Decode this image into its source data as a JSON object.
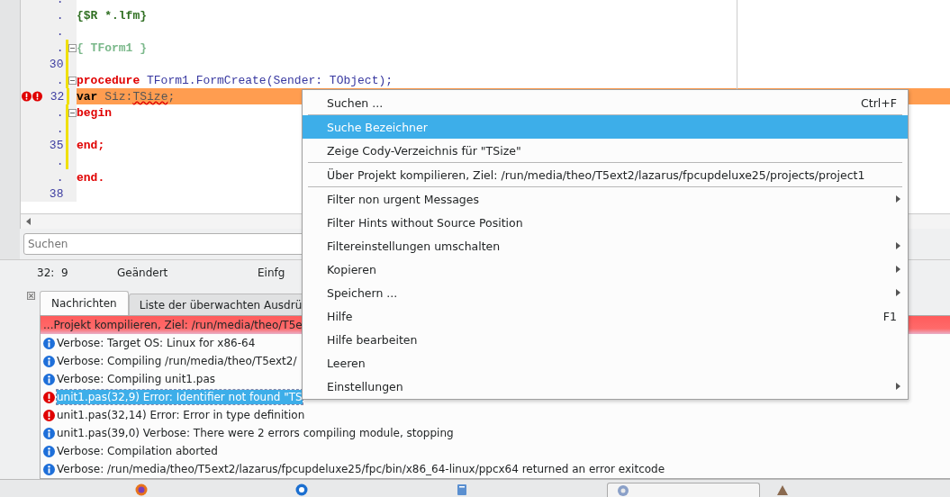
{
  "editor": {
    "lines": [
      {
        "number": ".",
        "modified": false,
        "fold": false,
        "highlighted": false,
        "error": false
      },
      {
        "number": ".",
        "modified": false,
        "fold": false,
        "highlighted": false,
        "error": false,
        "code": [
          {
            "kind": "directive",
            "text": "{$R *.lfm}"
          }
        ]
      },
      {
        "number": ".",
        "modified": false,
        "fold": false,
        "highlighted": false,
        "error": false
      },
      {
        "number": ".",
        "modified": true,
        "fold": true,
        "highlighted": false,
        "error": false,
        "code": [
          {
            "kind": "comment",
            "text": "{ TForm1 }"
          }
        ]
      },
      {
        "number": "30",
        "modified": true,
        "fold": false,
        "highlighted": false,
        "error": false
      },
      {
        "number": ".",
        "modified": true,
        "fold": true,
        "highlighted": false,
        "error": false,
        "code": [
          {
            "kind": "keyword",
            "text": "procedure"
          },
          {
            "kind": "ident",
            "text": " TForm1.FormCreate(Sender: TObject);"
          }
        ]
      },
      {
        "number": "32",
        "modified": true,
        "fold": false,
        "highlighted": true,
        "error": true,
        "code": [
          {
            "kind": "strong",
            "text": "var"
          },
          {
            "kind": "plain",
            "text": " Siz:"
          },
          {
            "kind": "error",
            "text": "TSize"
          },
          {
            "kind": "plain",
            "text": ";"
          }
        ]
      },
      {
        "number": ".",
        "modified": true,
        "fold": true,
        "highlighted": false,
        "error": false,
        "code": [
          {
            "kind": "keyword",
            "text": "begin"
          }
        ]
      },
      {
        "number": ".",
        "modified": true,
        "fold": false,
        "highlighted": false,
        "error": false
      },
      {
        "number": "35",
        "modified": true,
        "fold": false,
        "highlighted": false,
        "error": false,
        "code": [
          {
            "kind": "keyword",
            "text": "end;"
          }
        ]
      },
      {
        "number": ".",
        "modified": true,
        "fold": false,
        "highlighted": false,
        "error": false
      },
      {
        "number": ".",
        "modified": false,
        "fold": false,
        "highlighted": false,
        "error": false,
        "code": [
          {
            "kind": "keyword",
            "text": "end."
          }
        ]
      },
      {
        "number": "38",
        "modified": false,
        "fold": false,
        "highlighted": false,
        "error": false
      }
    ]
  },
  "search": {
    "placeholder": "Suchen"
  },
  "status_bar": {
    "position": "32:  9",
    "modified": "Geändert",
    "mode": "Einfg"
  },
  "messages": {
    "tabs": [
      {
        "label": "Nachrichten",
        "selected": true
      },
      {
        "label": "Liste der überwachten Ausdrü",
        "selected": false
      }
    ],
    "rows": [
      {
        "kind": "header",
        "selected": false,
        "text": "...Projekt kompilieren, Ziel: /run/media/theo/T5e"
      },
      {
        "kind": "info",
        "selected": false,
        "text": "Verbose: Target OS: Linux for x86-64"
      },
      {
        "kind": "info",
        "selected": false,
        "text": "Verbose: Compiling /run/media/theo/T5ext2/"
      },
      {
        "kind": "info",
        "selected": false,
        "text": "Verbose: Compiling unit1.pas"
      },
      {
        "kind": "error",
        "selected": true,
        "text": "unit1.pas(32,9) Error: Identifier not found \"TS"
      },
      {
        "kind": "error",
        "selected": false,
        "text": "unit1.pas(32,14) Error: Error in type definition"
      },
      {
        "kind": "info",
        "selected": false,
        "text": "unit1.pas(39,0) Verbose: There were 2 errors compiling module, stopping"
      },
      {
        "kind": "info",
        "selected": false,
        "text": "Verbose: Compilation aborted"
      },
      {
        "kind": "info",
        "selected": false,
        "text": "Verbose: /run/media/theo/T5ext2/lazarus/fpcupdeluxe25/fpc/bin/x86_64-linux/ppcx64 returned an error exitcode"
      }
    ]
  },
  "context_menu": {
    "items": [
      {
        "label": "Suchen ...",
        "shortcut": "Ctrl+F",
        "submenu": false,
        "selected": false,
        "separator_after": true
      },
      {
        "label": "Suche Bezeichner",
        "submenu": false,
        "selected": true,
        "separator_after": false
      },
      {
        "label": "Zeige Cody-Verzeichnis für \"TSize\"",
        "submenu": false,
        "selected": false,
        "separator_after": true
      },
      {
        "label": "Über Projekt kompilieren, Ziel: /run/media/theo/T5ext2/lazarus/fpcupdeluxe25/projects/project1",
        "submenu": false,
        "selected": false,
        "separator_after": true
      },
      {
        "label": "Filter non urgent Messages",
        "submenu": true,
        "selected": false,
        "separator_after": false
      },
      {
        "label": "Filter Hints without Source Position",
        "submenu": false,
        "selected": false,
        "separator_after": false
      },
      {
        "label": "Filtereinstellungen umschalten",
        "submenu": true,
        "selected": false,
        "separator_after": false
      },
      {
        "label": "Kopieren",
        "submenu": true,
        "selected": false,
        "separator_after": false
      },
      {
        "label": "Speichern ...",
        "submenu": true,
        "selected": false,
        "separator_after": false
      },
      {
        "label": "Hilfe",
        "shortcut": "F1",
        "submenu": false,
        "selected": false,
        "separator_after": false
      },
      {
        "label": "Hilfe bearbeiten",
        "submenu": false,
        "selected": false,
        "separator_after": false
      },
      {
        "label": "Leeren",
        "submenu": false,
        "selected": false,
        "separator_after": false
      },
      {
        "label": "Einstellungen",
        "submenu": true,
        "selected": false,
        "separator_after": false
      }
    ]
  }
}
